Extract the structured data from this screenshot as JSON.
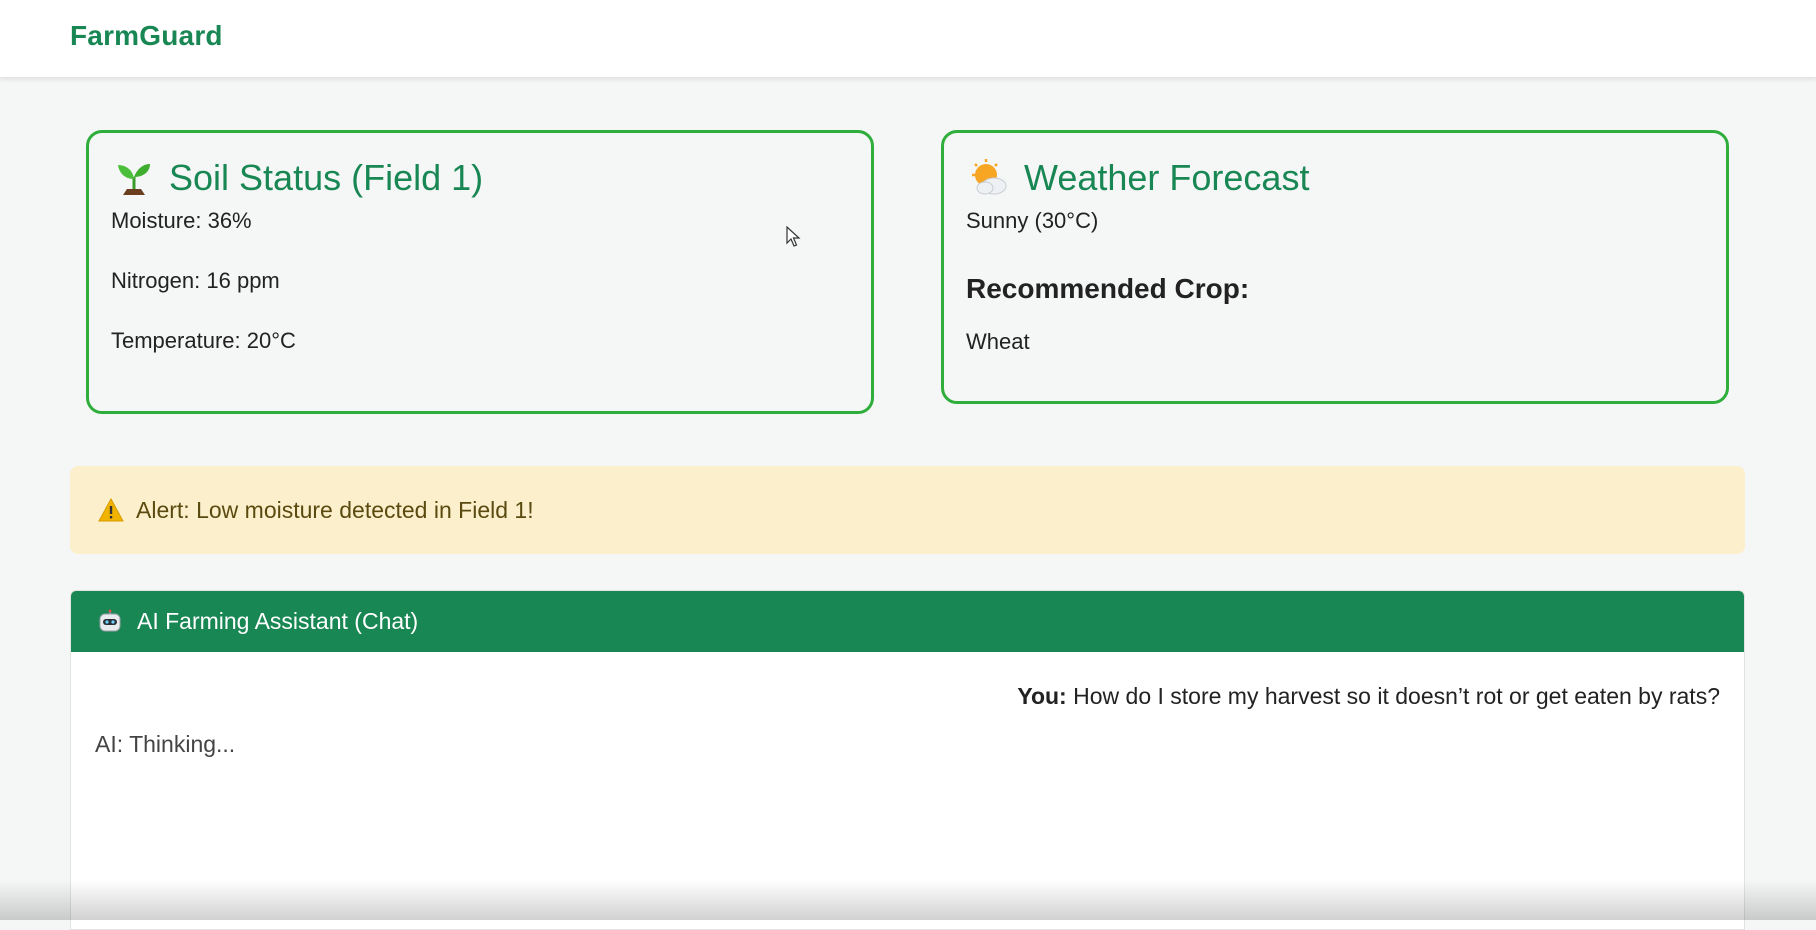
{
  "app": {
    "brand": "FarmGuard"
  },
  "soil": {
    "title": "Soil Status (Field 1)",
    "icon": "seedling-icon",
    "moisture": "Moisture: 36%",
    "nitrogen": "Nitrogen: 16 ppm",
    "temperature": "Temperature: 20°C"
  },
  "weather": {
    "title": "Weather Forecast",
    "icon": "sun-behind-cloud-icon",
    "condition": "Sunny (30°C)",
    "recommended_heading": "Recommended Crop:",
    "recommended_crop": "Wheat"
  },
  "alert": {
    "icon": "warning-icon",
    "text": "Alert: Low moisture detected in Field 1!"
  },
  "chat": {
    "icon": "robot-icon",
    "title": "AI Farming Assistant (Chat)",
    "messages": [
      {
        "sender": "You:",
        "text": " How do I store my harvest so it doesn’t rot or get eaten by rats?"
      },
      {
        "sender": "AI",
        "text": "AI: Thinking..."
      }
    ]
  },
  "colors": {
    "brand_green": "#198754",
    "card_border": "#2fae3c",
    "alert_bg": "#fcf0cc"
  }
}
